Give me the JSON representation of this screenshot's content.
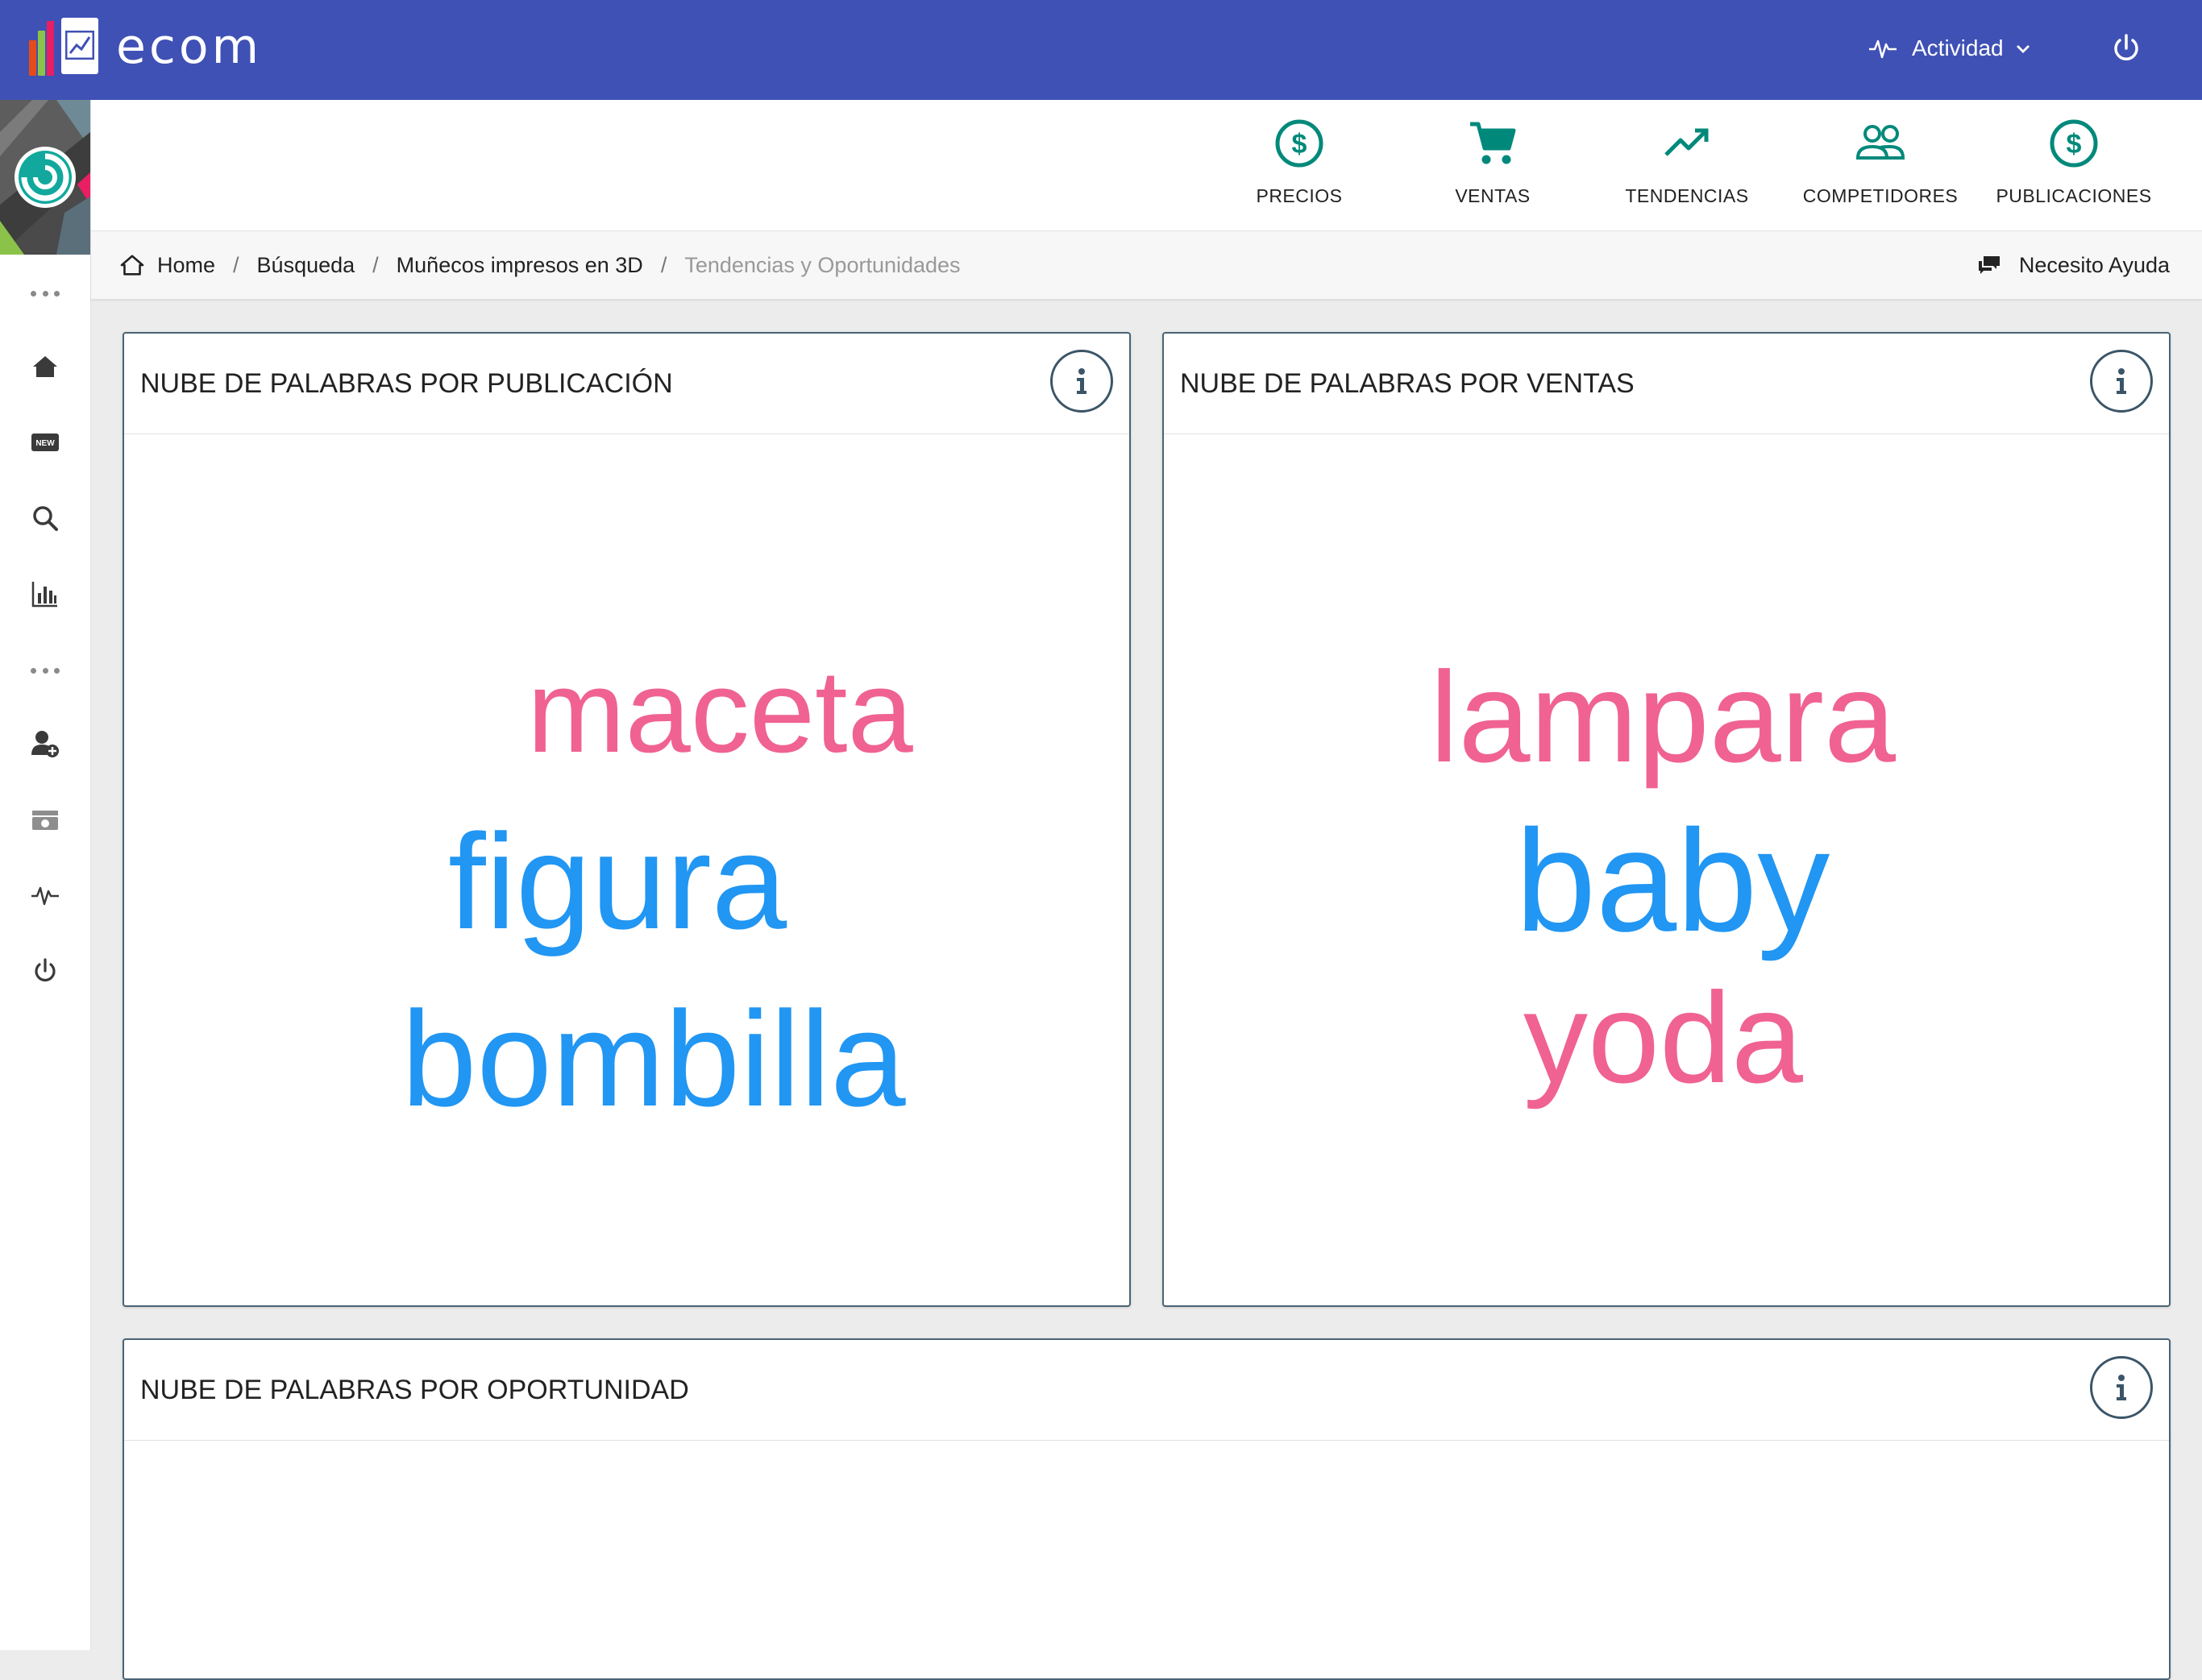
{
  "app": {
    "name": "ecom"
  },
  "header": {
    "activity_label": "Actividad"
  },
  "colors": {
    "primary": "#3f51b5",
    "accent_green": "#00897b",
    "word_pink": "#f06292",
    "word_blue": "#2196f3"
  },
  "top_nav": [
    {
      "label": "PRECIOS",
      "icon": "dollar-circle-icon"
    },
    {
      "label": "VENTAS",
      "icon": "cart-icon"
    },
    {
      "label": "TENDENCIAS",
      "icon": "trending-up-icon"
    },
    {
      "label": "COMPETIDORES",
      "icon": "people-icon"
    },
    {
      "label": "PUBLICACIONES",
      "icon": "dollar-circle-icon"
    }
  ],
  "breadcrumb": {
    "items": [
      "Home",
      "Búsqueda",
      "Muñecos impresos en 3D"
    ],
    "current": "Tendencias y Oportunidades"
  },
  "help": {
    "label": "Necesito Ayuda"
  },
  "sidebar": {
    "icons": [
      "more-icon",
      "home-icon",
      "new-badge-icon",
      "search-icon",
      "bar-chart-icon",
      "more-icon",
      "add-user-icon",
      "cash-icon",
      "activity-icon",
      "power-icon"
    ]
  },
  "cards": [
    {
      "title": "NUBE DE PALABRAS POR PUBLICACIÓN",
      "words": [
        {
          "text": "maceta",
          "color": "pink"
        },
        {
          "text": "figura",
          "color": "blue"
        },
        {
          "text": "bombilla",
          "color": "blue"
        }
      ]
    },
    {
      "title": "NUBE DE PALABRAS POR VENTAS",
      "words": [
        {
          "text": "lampara",
          "color": "pink"
        },
        {
          "text": "baby",
          "color": "blue"
        },
        {
          "text": "yoda",
          "color": "pink"
        }
      ]
    },
    {
      "title": "NUBE DE PALABRAS POR OPORTUNIDAD",
      "words": []
    }
  ]
}
